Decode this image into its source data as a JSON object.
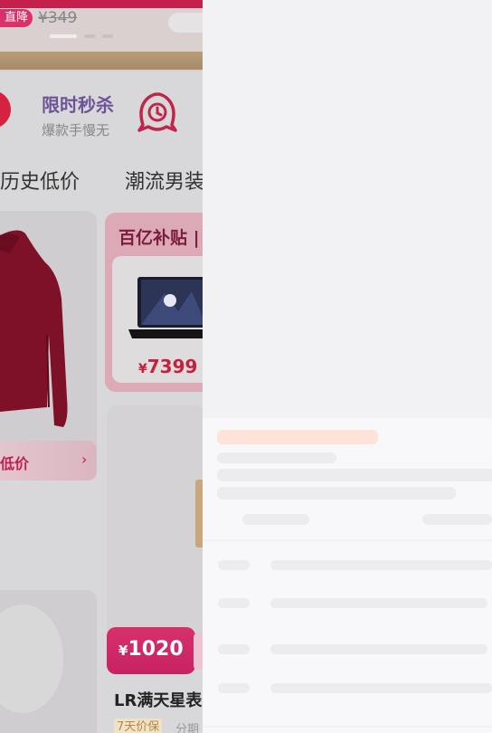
{
  "background_app": {
    "banner": {
      "badge": "直降",
      "old_price": "¥349"
    },
    "flash_sale": {
      "title": "限时秒杀",
      "subtitle": "爆款手慢无"
    },
    "categories": [
      "历史低价",
      "潮流男装"
    ],
    "left_card": {
      "label": "低价",
      "chevron": "›"
    },
    "subsidy_card": {
      "title": "百亿补贴 |",
      "price_symbol": "¥",
      "price": "7399"
    },
    "product": {
      "price_symbol": "¥",
      "price": "1020",
      "name": "LR满天星表",
      "guarantee": "7天价保",
      "installment": "分期"
    },
    "colors": {
      "accent": "#c51f4b",
      "flash_title": "#6e5497",
      "price_red": "#c4213c"
    }
  },
  "loading_panel": {
    "state": "skeleton-loading",
    "colors": {
      "bone": "#ececee",
      "highlight": "#fde3d8"
    }
  }
}
